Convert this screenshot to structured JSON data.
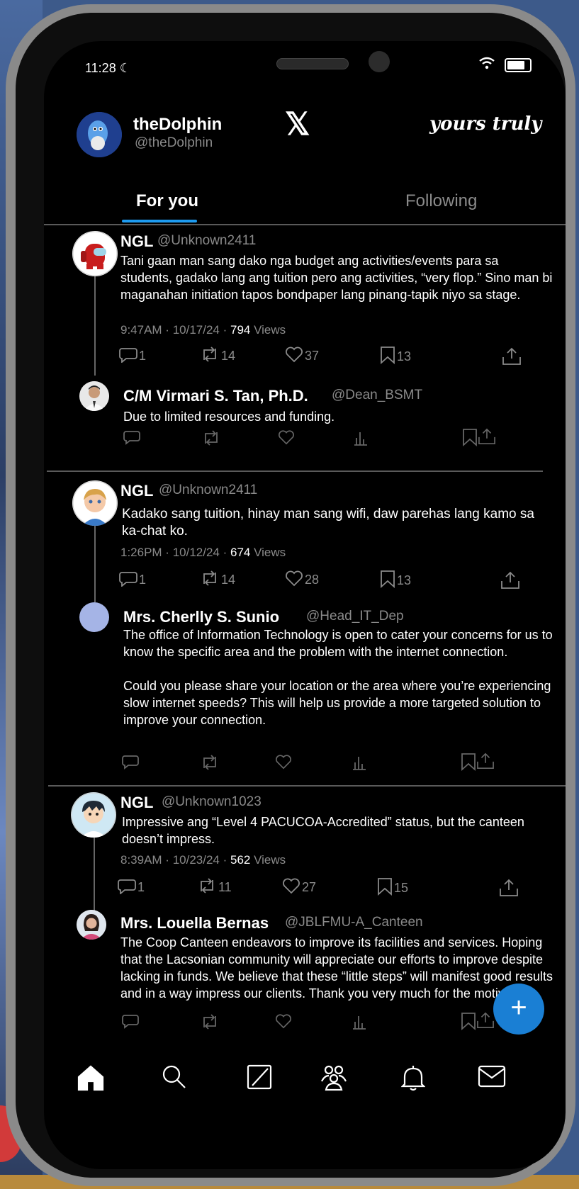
{
  "status_bar": {
    "time": "11:28"
  },
  "profile": {
    "name": "theDolphin",
    "handle": "@theDolphin"
  },
  "header": {
    "logo": "𝕏",
    "tagline": "yours truly"
  },
  "tabs": [
    {
      "label": "For you"
    },
    {
      "label": "Following"
    }
  ],
  "colors": {
    "accent": "#1d9bf0",
    "fab": "#1a7fd4",
    "background": "#000000",
    "muted": "#8a8a8a"
  },
  "threads": [
    {
      "post": {
        "name": "NGL",
        "handle": "@Unknown2411",
        "body": "Tani gaan man sang dako nga budget ang activities/events para sa students, gadako lang ang tuition pero ang activities, “very flop.” Sino man bi maganahan initiation tapos bondpaper lang pinang-tapik niyo sa stage.",
        "time": "9:47AM · 10/17/24 ·",
        "views_count": "794",
        "views_label": "Views",
        "replies": "1",
        "reposts": "14",
        "likes": "37",
        "bookmarks": "13"
      },
      "reply": {
        "name": "C/M Virmari S. Tan, Ph.D.",
        "handle": "@Dean_BSMT",
        "body": "Due to limited resources and funding."
      }
    },
    {
      "post": {
        "name": "NGL",
        "handle": "@Unknown2411",
        "body": "Kadako sang tuition, hinay man sang wifi, daw parehas lang kamo sa ka-chat ko.",
        "time": "1:26PM · 10/12/24 ·",
        "views_count": "674",
        "views_label": "Views",
        "replies": "1",
        "reposts": "14",
        "likes": "28",
        "bookmarks": "13"
      },
      "reply": {
        "name": "Mrs. Cherlly S. Sunio",
        "handle": "@Head_IT_Dep",
        "body_p1": "The office of Information Technology is open to cater your concerns for us to know the specific area and the problem with the internet connection.",
        "body_p2": "Could you please share your location or the area where you’re experiencing slow internet speeds? This will help us provide a more targeted solution to improve your connection."
      }
    },
    {
      "post": {
        "name": "NGL",
        "handle": "@Unknown1023",
        "body": "Impressive ang “Level 4 PACUCOA-Accredited” status, but the canteen doesn’t impress.",
        "time": "8:39AM · 10/23/24 ·",
        "views_count": "562",
        "views_label": "Views",
        "replies": "1",
        "reposts": "11",
        "likes": "27",
        "bookmarks": "15"
      },
      "reply": {
        "name": "Mrs. Louella Bernas",
        "handle": "@JBLFMU-A_Canteen",
        "body": "The Coop Canteen endeavors to improve its facilities and services. Hoping that the Lacsonian community will appreciate our efforts to improve despite lacking in funds. We believe that these “little steps” will manifest good results and in a way impress our clients. Thank you very much for the motivation."
      }
    }
  ],
  "fab": {
    "label": "+"
  },
  "bottom_nav": [
    "home-icon",
    "search-icon",
    "grok-icon",
    "communities-icon",
    "notifications-icon",
    "messages-icon"
  ]
}
